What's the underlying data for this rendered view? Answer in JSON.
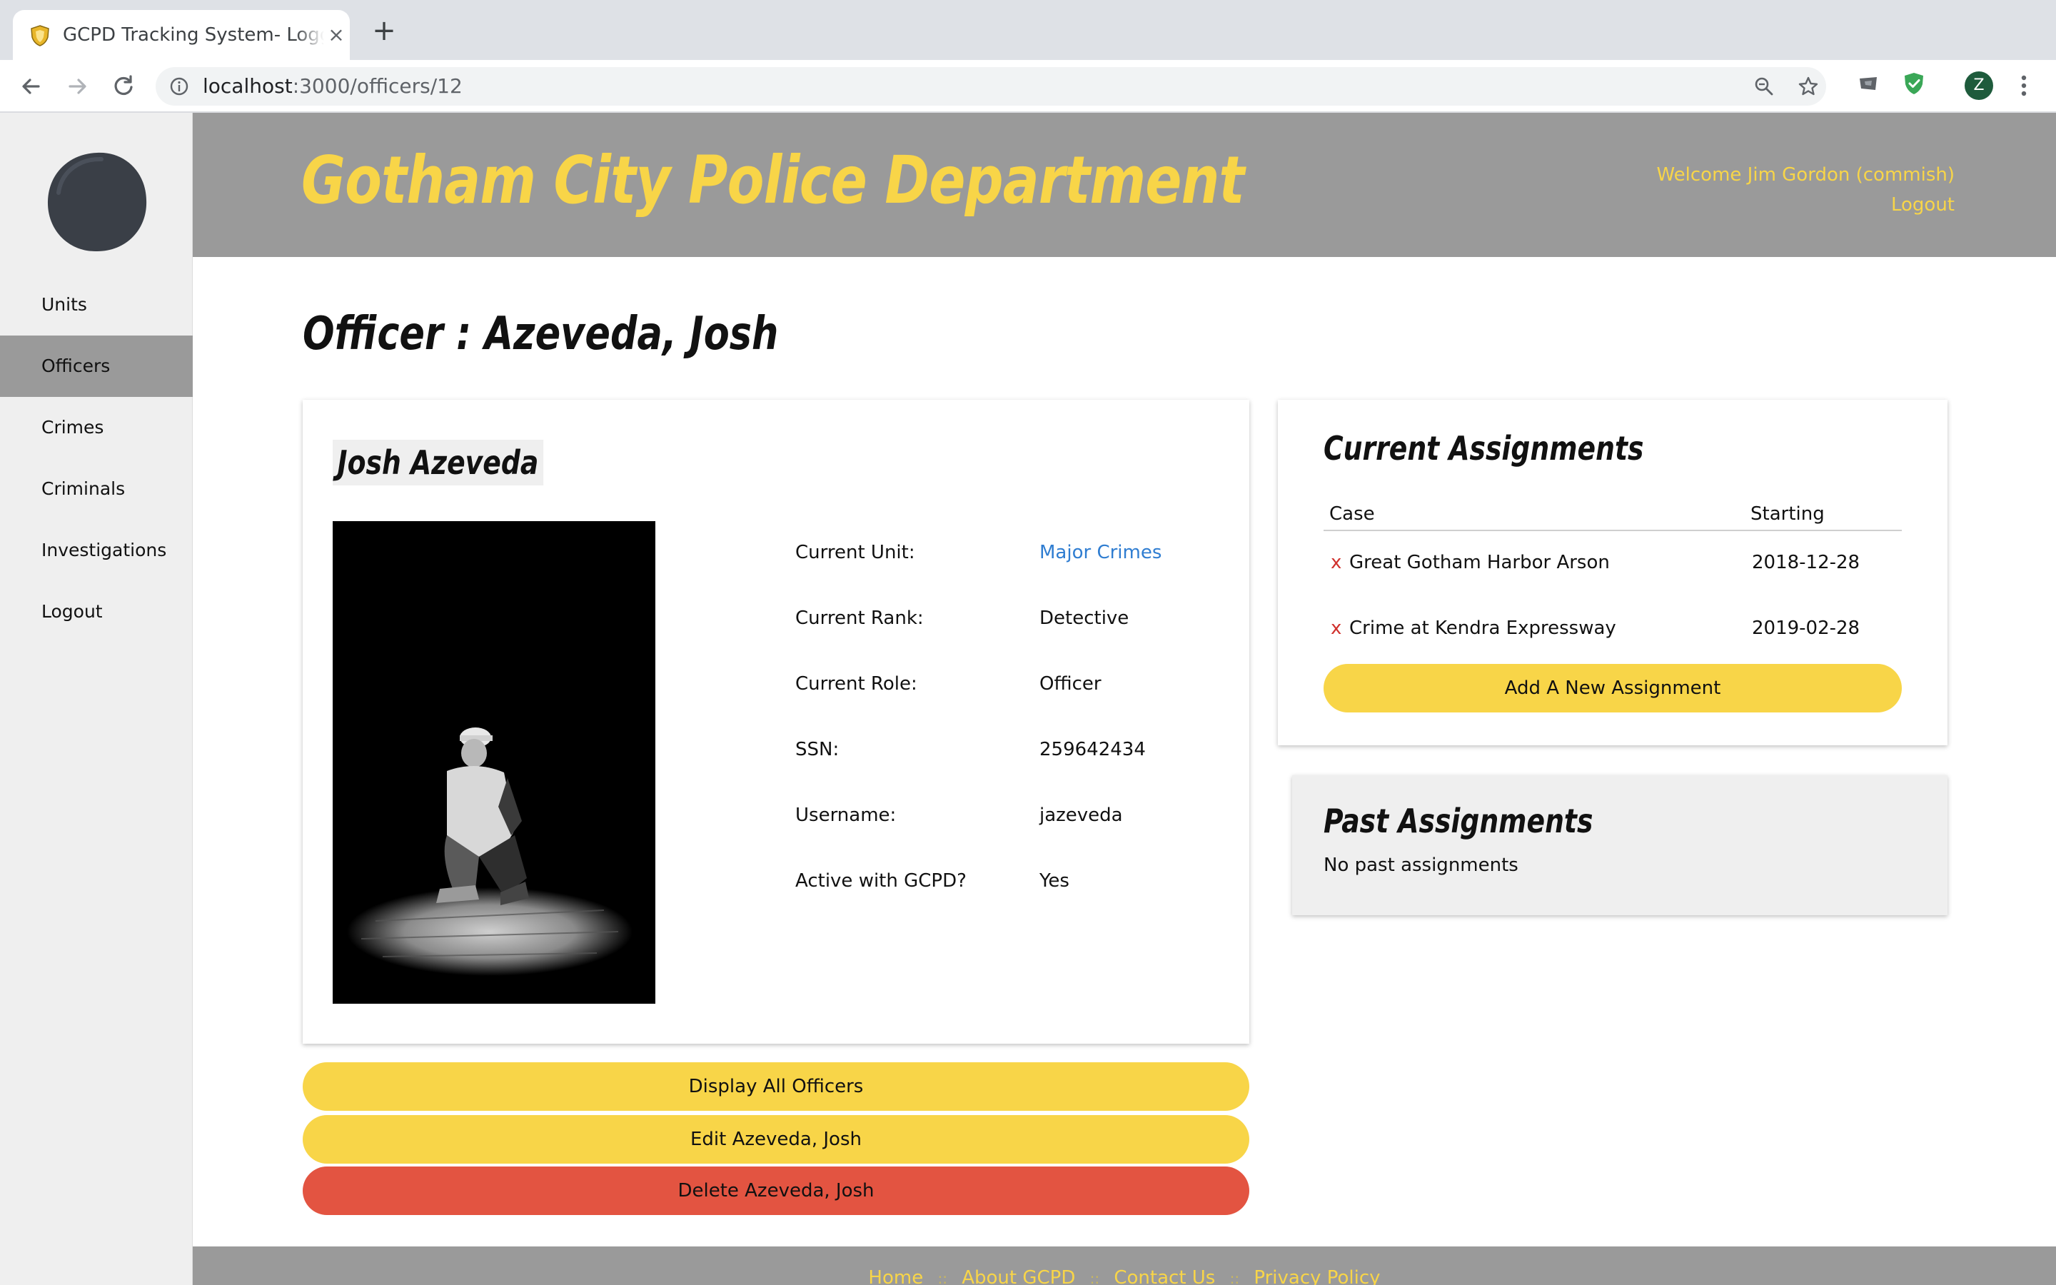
{
  "browser": {
    "tab_title": "GCPD Tracking System- Logged In",
    "new_tab_symbol": "+",
    "url_host": "localhost",
    "url_path": ":3000/officers/12",
    "profile_initial": "Z"
  },
  "sidebar": {
    "items": [
      {
        "label": "Units"
      },
      {
        "label": "Officers",
        "active": true
      },
      {
        "label": "Crimes"
      },
      {
        "label": "Criminals"
      },
      {
        "label": "Investigations"
      },
      {
        "label": "Logout"
      }
    ]
  },
  "header": {
    "brand": "Gotham City Police Department",
    "welcome": "Welcome Jim Gordon (commish)",
    "logout": "Logout"
  },
  "page": {
    "title": "Officer : Azeveda, Josh"
  },
  "officer": {
    "name": "Josh Azeveda",
    "details": [
      {
        "label": "Current Unit:",
        "value": "Major Crimes",
        "link": true
      },
      {
        "label": "Current Rank:",
        "value": "Detective"
      },
      {
        "label": "Current Role:",
        "value": "Officer"
      },
      {
        "label": "SSN:",
        "value": "259642434"
      },
      {
        "label": "Username:",
        "value": "jazeveda"
      },
      {
        "label": "Active with GCPD?",
        "value": "Yes"
      }
    ]
  },
  "actions": {
    "display_all": "Display All Officers",
    "edit": "Edit Azeveda, Josh",
    "delete": "Delete Azeveda, Josh"
  },
  "current_assignments": {
    "title": "Current Assignments",
    "columns": [
      "Case",
      "Starting"
    ],
    "rows": [
      {
        "remove": "x",
        "case": "Great Gotham Harbor Arson",
        "starting": "2018-12-28"
      },
      {
        "remove": "x",
        "case": "Crime at Kendra Expressway",
        "starting": "2019-02-28"
      }
    ],
    "add_button": "Add A New Assignment"
  },
  "past_assignments": {
    "title": "Past Assignments",
    "empty": "No past assignments"
  },
  "footer": {
    "links": [
      "Home",
      "About GCPD",
      "Contact Us",
      "Privacy Policy"
    ],
    "separator": "::"
  },
  "colors": {
    "accent_yellow": "#f8d548",
    "danger_red": "#e35441",
    "header_gray": "#9a9a9a",
    "link_blue": "#2f7dd1"
  },
  "icons": [
    "shield-favicon-icon",
    "close-icon",
    "plus-icon",
    "back-arrow-icon",
    "forward-arrow-icon",
    "reload-icon",
    "info-icon",
    "zoom-icon",
    "star-icon",
    "extension-icon",
    "shield-extension-icon",
    "kebab-menu-icon"
  ]
}
